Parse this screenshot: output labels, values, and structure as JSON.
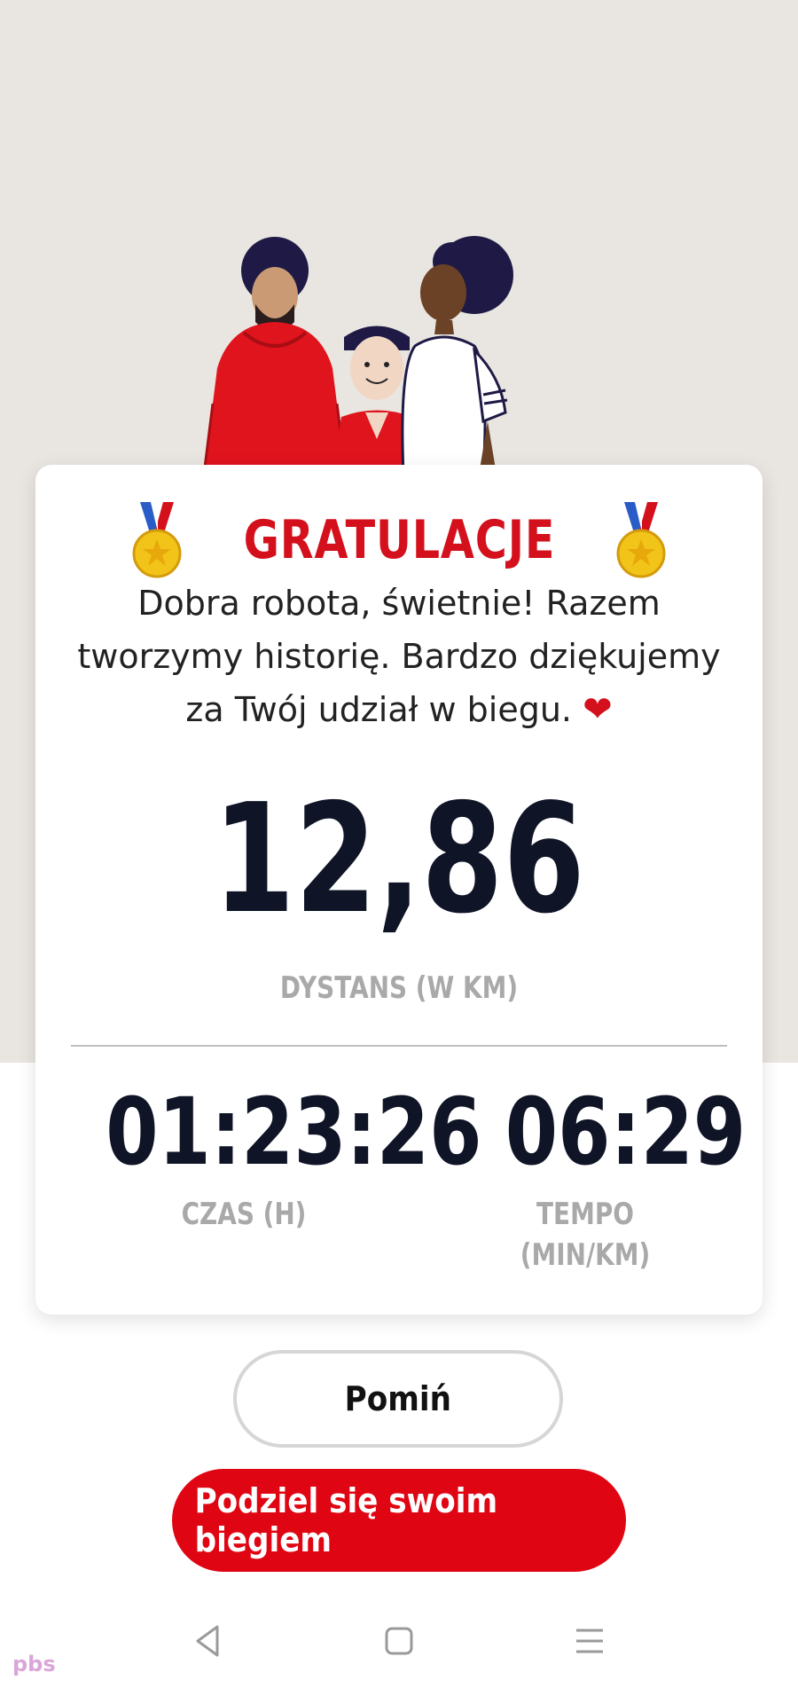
{
  "card": {
    "title": "GRATULACJE",
    "message": "Dobra robota, świetnie! Razem tworzymy historię. Bardzo dziękujemy za Twój udział w biegu.",
    "heart": "❤"
  },
  "stats": {
    "distance": {
      "value": "12,86",
      "label": "DYSTANS (W KM)"
    },
    "time": {
      "value": "01:23:26",
      "label": "CZAS (H)"
    },
    "pace": {
      "value": "06:29",
      "label": "TEMPO (MIN/KM)"
    }
  },
  "buttons": {
    "skip": "Pomiń",
    "share": "Podziel się swoim biegiem"
  },
  "watermark": "pbs",
  "colors": {
    "accent": "#e00512",
    "title": "#d3101c",
    "dark_text": "#0f1426",
    "muted_text": "#a9a9a9",
    "hero_background": "#e9e5e0"
  },
  "icons": [
    "medal-icon",
    "heart-icon",
    "back-nav-icon",
    "home-nav-icon",
    "menu-nav-icon"
  ]
}
